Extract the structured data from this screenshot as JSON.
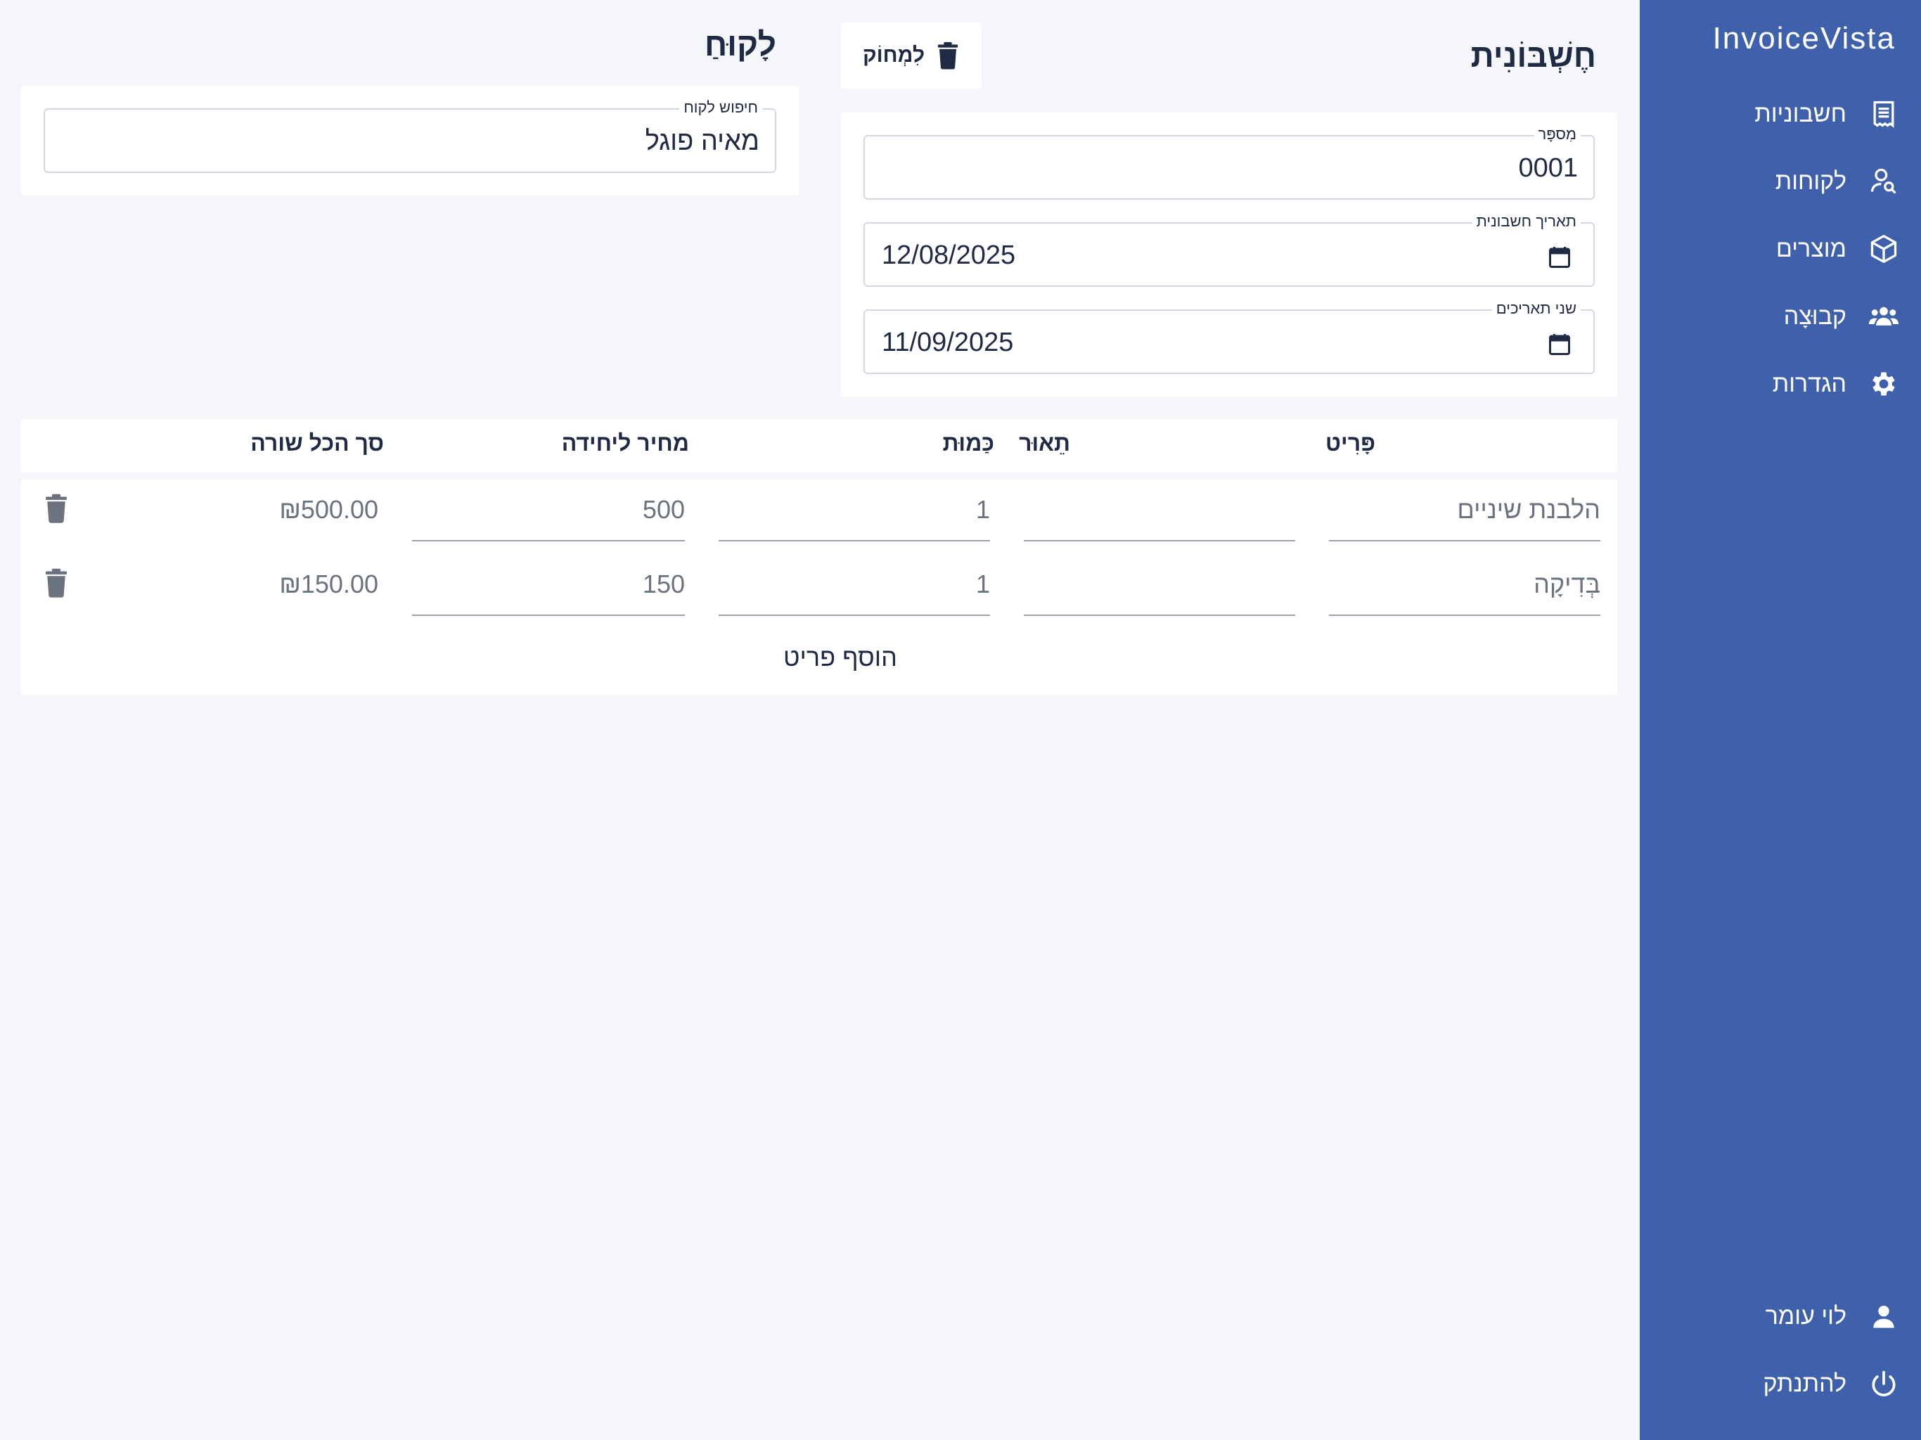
{
  "brand": "InvoiceVista",
  "nav": [
    {
      "label": "חשבוניות",
      "icon": "receipt-icon"
    },
    {
      "label": "לקוחות",
      "icon": "user-search-icon"
    },
    {
      "label": "מוצרים",
      "icon": "cube-icon"
    },
    {
      "label": "קבוּצָה",
      "icon": "group-icon"
    },
    {
      "label": "הגדרות",
      "icon": "gear-icon"
    }
  ],
  "user": {
    "name": "לוי עומר",
    "icon": "user-icon"
  },
  "logout": {
    "label": "להתנתק",
    "icon": "power-icon"
  },
  "invoice": {
    "title": "חֶשְׁבּוֹנִית",
    "delete_label": "לִמְחוֹק",
    "number_label": "מִספָּר",
    "number_value": "0001",
    "date_label": "תאריך חשבונית",
    "date_value": "12/08/2025",
    "due_label": "שני תאריכים",
    "due_value": "11/09/2025"
  },
  "customer": {
    "title": "לָקוּחַ",
    "search_label": "חיפוש לקוח",
    "search_value": "מאיה פוגל"
  },
  "table": {
    "headers": {
      "item": "פָּרִיט",
      "desc": "תֵאוּר",
      "qty": "כַּמוּת",
      "price": "מחיר ליחידה",
      "total": "סך הכל שורה"
    },
    "rows": [
      {
        "item": "הלבנת שיניים",
        "desc": "",
        "qty": "1",
        "price": "500",
        "total": "₪500.00"
      },
      {
        "item": "בְּדִיקָה",
        "desc": "",
        "qty": "1",
        "price": "150",
        "total": "₪150.00"
      }
    ],
    "add_label": "הוסף פריט"
  },
  "colors": {
    "sidebar": "#3f60aa",
    "background": "#f4f6fa",
    "text": "#1f2a44"
  }
}
